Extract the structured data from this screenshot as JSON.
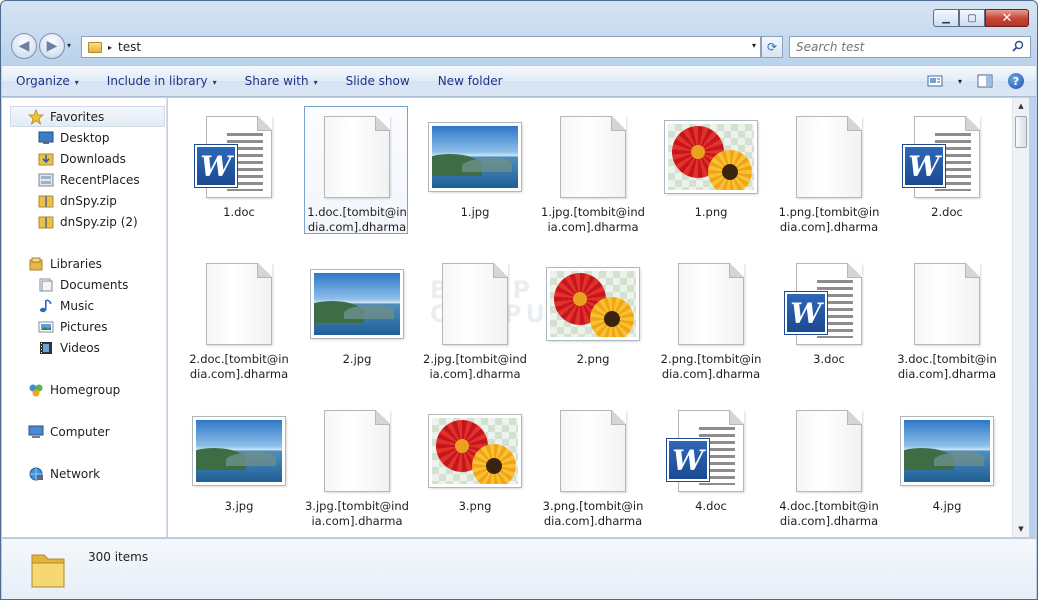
{
  "window": {
    "minimize": "▁",
    "maximize": "▢",
    "close": "✕"
  },
  "nav": {
    "back": "◀",
    "forward": "▶",
    "history": "▾"
  },
  "address": {
    "folder": "test",
    "arrow": "▸",
    "dropdown": "▾"
  },
  "refresh": "⟳",
  "search": {
    "placeholder": "Search test"
  },
  "toolbar": {
    "items": [
      {
        "label": "Organize",
        "arrow": "▾"
      },
      {
        "label": "Include in library",
        "arrow": "▾"
      },
      {
        "label": "Share with",
        "arrow": "▾"
      },
      {
        "label": "Slide show",
        "arrow": ""
      },
      {
        "label": "New folder",
        "arrow": ""
      }
    ],
    "view_arrow": "▾",
    "help": "?"
  },
  "sidebar": {
    "favorites": {
      "label": "Favorites",
      "items": [
        "Desktop",
        "Downloads",
        "RecentPlaces",
        "dnSpy.zip",
        "dnSpy.zip (2)"
      ]
    },
    "libraries": {
      "label": "Libraries",
      "items": [
        "Documents",
        "Music",
        "Pictures",
        "Videos"
      ]
    },
    "homegroup": "Homegroup",
    "computer": "Computer",
    "network": "Network"
  },
  "files": [
    {
      "name": "1.doc",
      "type": "doc"
    },
    {
      "name": "1.doc.[tombit@india.com].dharma",
      "type": "blank",
      "selected": true
    },
    {
      "name": "1.jpg",
      "type": "jpg"
    },
    {
      "name": "1.jpg.[tombit@india.com].dharma",
      "type": "blank"
    },
    {
      "name": "1.png",
      "type": "png"
    },
    {
      "name": "1.png.[tombit@india.com].dharma",
      "type": "blank"
    },
    {
      "name": "2.doc",
      "type": "doc"
    },
    {
      "name": "2.doc.[tombit@india.com].dharma",
      "type": "blank"
    },
    {
      "name": "2.jpg",
      "type": "jpg"
    },
    {
      "name": "2.jpg.[tombit@india.com].dharma",
      "type": "blank"
    },
    {
      "name": "2.png",
      "type": "png"
    },
    {
      "name": "2.png.[tombit@india.com].dharma",
      "type": "blank"
    },
    {
      "name": "3.doc",
      "type": "doc"
    },
    {
      "name": "3.doc.[tombit@india.com].dharma",
      "type": "blank"
    },
    {
      "name": "3.jpg",
      "type": "jpg"
    },
    {
      "name": "3.jpg.[tombit@india.com].dharma",
      "type": "blank"
    },
    {
      "name": "3.png",
      "type": "png"
    },
    {
      "name": "3.png.[tombit@india.com].dharma",
      "type": "blank"
    },
    {
      "name": "4.doc",
      "type": "doc"
    },
    {
      "name": "4.doc.[tombit@india.com].dharma",
      "type": "blank"
    },
    {
      "name": "4.jpg",
      "type": "jpg"
    }
  ],
  "watermark": [
    "BLEEP",
    "COMPU"
  ],
  "scroll": {
    "up": "▲",
    "down": "▼"
  },
  "details": {
    "count": "300 items"
  },
  "colors": {
    "accent": "#1e3287",
    "frame": "#bcd3ec",
    "word": "#2d67b8"
  }
}
